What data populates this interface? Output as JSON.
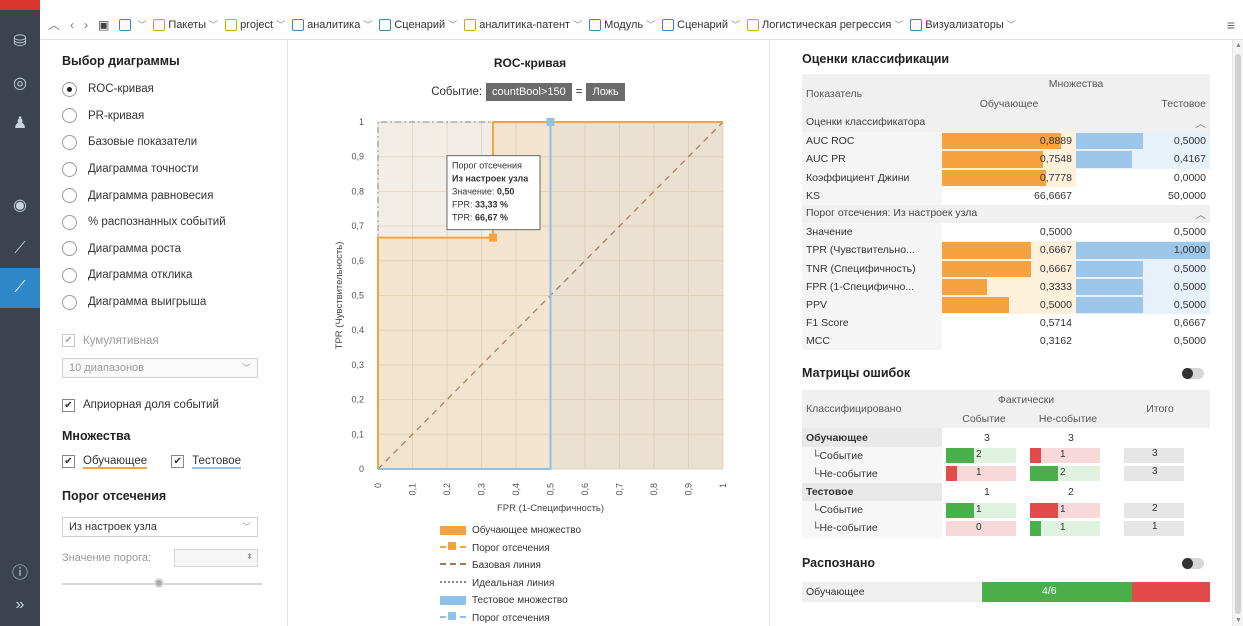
{
  "rail": {
    "icons": [
      "database-icon",
      "compass-icon",
      "users-icon",
      "eye-icon",
      "formula-chart-icon",
      "roc-chart-icon",
      "info-icon",
      "expand-icon"
    ]
  },
  "topbar": {
    "crumbs": [
      {
        "label": "",
        "icon": "sitemap-icon",
        "color": "#2f87c8"
      },
      {
        "label": "Пакеты",
        "icon": "database-icon",
        "color": "#e0a000"
      },
      {
        "label": "project",
        "icon": "database-icon",
        "color": "#e0a000"
      },
      {
        "label": "аналитика",
        "icon": "module-icon",
        "color": "#2f87c8"
      },
      {
        "label": "Сценарий",
        "icon": "scenario-icon",
        "color": "#2f87c8"
      },
      {
        "label": "аналитика-патент",
        "icon": "package-icon",
        "color": "#e0a000"
      },
      {
        "label": "Модуль",
        "icon": "module-icon",
        "color": "#2f87c8"
      },
      {
        "label": "Сценарий",
        "icon": "scenario-icon",
        "color": "#2f87c8"
      },
      {
        "label": "Логистическая регрессия",
        "icon": "regression-icon",
        "color": "#e0a000"
      },
      {
        "label": "Визуализаторы",
        "icon": "eye-icon",
        "color": "#2f87c8"
      }
    ]
  },
  "left": {
    "chart_select_title": "Выбор диаграммы",
    "chart_types": [
      {
        "label": "ROC-кривая",
        "selected": true
      },
      {
        "label": "PR-кривая",
        "selected": false
      },
      {
        "label": "Базовые показатели",
        "selected": false
      },
      {
        "label": "Диаграмма точности",
        "selected": false
      },
      {
        "label": "Диаграмма равновесия",
        "selected": false
      },
      {
        "label": "% распознанных событий",
        "selected": false
      },
      {
        "label": "Диаграмма роста",
        "selected": false
      },
      {
        "label": "Диаграмма отклика",
        "selected": false
      },
      {
        "label": "Диаграмма выигрыша",
        "selected": false
      }
    ],
    "cumulative_label": "Кумулятивная",
    "ranges_value": "10 диапазонов",
    "apriori_label": "Априорная доля событий",
    "sets_title": "Множества",
    "set_train": "Обучающее",
    "set_test": "Тестовое",
    "threshold_title": "Порог отсечения",
    "threshold_value": "Из настроек узла",
    "threshold_value_label": "Значение порога:"
  },
  "center": {
    "title": "ROC-кривая",
    "event_label": "Событие:",
    "event_var": "countBool>150",
    "equals": "=",
    "event_val": "Ложь",
    "tooltip": {
      "line1": "Порог отсечения",
      "line2": "Из настроек узла",
      "value_label": "Значение:",
      "value": "0,50",
      "fpr_label": "FPR:",
      "fpr": "33,33 %",
      "tpr_label": "TPR:",
      "tpr": "66,67 %"
    },
    "legend": [
      {
        "label": "Обучающее множество",
        "kind": "area-orange"
      },
      {
        "label": "Порог отсечения",
        "kind": "dash-orange-square"
      },
      {
        "label": "Базовая линия",
        "kind": "dash-brown"
      },
      {
        "label": "Идеальная линия",
        "kind": "dashdot-gray"
      },
      {
        "label": "Тестовое множество",
        "kind": "area-blue"
      },
      {
        "label": "Порог отсечения",
        "kind": "dash-blue-square"
      }
    ]
  },
  "chart_data": {
    "type": "line",
    "title": "ROC-кривая",
    "xlabel": "FPR (1-Специфичность)",
    "ylabel": "TPR (Чувствительность)",
    "xlim": [
      0,
      1
    ],
    "ylim": [
      0,
      1
    ],
    "x_ticks": [
      "0",
      "0,1",
      "0,2",
      "0,3",
      "0,4",
      "0,5",
      "0,6",
      "0,7",
      "0,8",
      "0,9",
      "1"
    ],
    "y_ticks": [
      "0",
      "0,1",
      "0,2",
      "0,3",
      "0,4",
      "0,5",
      "0,6",
      "0,7",
      "0,8",
      "0,9",
      "1"
    ],
    "series": [
      {
        "name": "Обучающее множество",
        "color": "#f5a340",
        "points": [
          [
            0,
            0
          ],
          [
            0,
            0.6667
          ],
          [
            0.3333,
            0.6667
          ],
          [
            0.3333,
            1
          ],
          [
            1,
            1
          ]
        ]
      },
      {
        "name": "Тестовое множество",
        "color": "#8fc1e8",
        "points": [
          [
            0,
            0
          ],
          [
            0.5,
            0
          ],
          [
            0.5,
            1
          ],
          [
            1,
            1
          ]
        ]
      },
      {
        "name": "Базовая линия",
        "color": "#a0785a",
        "points": [
          [
            0,
            0
          ],
          [
            1,
            1
          ]
        ]
      },
      {
        "name": "Идеальная линия",
        "color": "#999999",
        "points": [
          [
            0,
            0
          ],
          [
            0,
            1
          ],
          [
            1,
            1
          ]
        ]
      }
    ],
    "thresholds": [
      {
        "name": "Порог отсечения",
        "color": "#f5a340",
        "x": 0.3333,
        "y": 0.6667
      },
      {
        "name": "Порог отсечения",
        "color": "#8fc1e8",
        "x": 0.5,
        "y": 1
      }
    ]
  },
  "right": {
    "scores_title": "Оценки классификации",
    "col_metric": "Показатель",
    "col_sets": "Множества",
    "col_train": "Обучающее",
    "col_test": "Тестовое",
    "group1": "Оценки классификатора",
    "group2": "Порог отсечения: Из настроек узла",
    "rows1": [
      {
        "name": "AUC ROC",
        "train": "0,8889",
        "test": "0,5000",
        "tf": 0.8889,
        "sf": 0.5,
        "tb": "#f5a340",
        "sb": "#9cc6ea"
      },
      {
        "name": "AUC PR",
        "train": "0,7548",
        "test": "0,4167",
        "tf": 0.7548,
        "sf": 0.4167,
        "tb": "#f5a340",
        "sb": "#9cc6ea"
      },
      {
        "name": "Коэффициент Джини",
        "train": "0,7778",
        "test": "0,0000",
        "tf": 0.7778,
        "sf": 0,
        "tb": "#f5a340",
        "sb": "#9cc6ea"
      },
      {
        "name": "KS",
        "train": "66,6667",
        "test": "50,0000",
        "tf": 0,
        "sf": 0,
        "tb": "#f5a340",
        "sb": "#9cc6ea"
      }
    ],
    "rows2": [
      {
        "name": "Значение",
        "train": "0,5000",
        "test": "0,5000",
        "tf": 0,
        "sf": 0,
        "tb": "#f5a340",
        "sb": "#9cc6ea"
      },
      {
        "name": "TPR (Чувствительно...",
        "train": "0,6667",
        "test": "1,0000",
        "tf": 0.6667,
        "sf": 1,
        "tb": "#f5a340",
        "sb": "#9cc6ea"
      },
      {
        "name": "TNR (Специфичность)",
        "train": "0,6667",
        "test": "0,5000",
        "tf": 0.6667,
        "sf": 0.5,
        "tb": "#f5a340",
        "sb": "#9cc6ea"
      },
      {
        "name": "FPR (1-Специфично...",
        "train": "0,3333",
        "test": "0,5000",
        "tf": 0.3333,
        "sf": 0.5,
        "tb": "#f5a340",
        "sb": "#9cc6ea"
      },
      {
        "name": "PPV",
        "train": "0,5000",
        "test": "0,5000",
        "tf": 0.5,
        "sf": 0.5,
        "tb": "#f5a340",
        "sb": "#9cc6ea"
      },
      {
        "name": "F1 Score",
        "train": "0,5714",
        "test": "0,6667",
        "tf": 0,
        "sf": 0,
        "tb": "#f5a340",
        "sb": "#9cc6ea"
      },
      {
        "name": "MCC",
        "train": "0,3162",
        "test": "0,5000",
        "tf": 0,
        "sf": 0,
        "tb": "#f5a340",
        "sb": "#9cc6ea"
      }
    ],
    "matrix_title": "Матрицы ошибок",
    "cm_classified": "Классифицировано",
    "cm_actual": "Фактически",
    "cm_event": "Событие",
    "cm_nonevent": "Не-событие",
    "cm_total": "Итого",
    "cm_rows": [
      {
        "label": "Обучающее",
        "group": true,
        "a": "3",
        "b": "3",
        "t": ""
      },
      {
        "label": "Событие",
        "group": false,
        "a": "2",
        "b": "1",
        "t": "3",
        "af": 0.4,
        "ac": "#4bb04b",
        "bf": 0.15,
        "bc": "#e34b4b"
      },
      {
        "label": "Не-событие",
        "group": false,
        "a": "1",
        "b": "2",
        "t": "3",
        "af": 0.15,
        "ac": "#e34b4b",
        "bf": 0.4,
        "bc": "#4bb04b"
      },
      {
        "label": "Тестовое",
        "group": true,
        "a": "1",
        "b": "2",
        "t": ""
      },
      {
        "label": "Событие",
        "group": false,
        "a": "1",
        "b": "1",
        "t": "2",
        "af": 0.4,
        "ac": "#4bb04b",
        "bf": 0.4,
        "bc": "#e34b4b"
      },
      {
        "label": "Не-событие",
        "group": false,
        "a": "0",
        "b": "1",
        "t": "1",
        "af": 0,
        "ac": "#e34b4b",
        "bf": 0.15,
        "bc": "#4bb04b"
      }
    ],
    "recognized_title": "Распознано",
    "recognized_row_label": "Обучающее",
    "recognized_value": "4/6"
  }
}
